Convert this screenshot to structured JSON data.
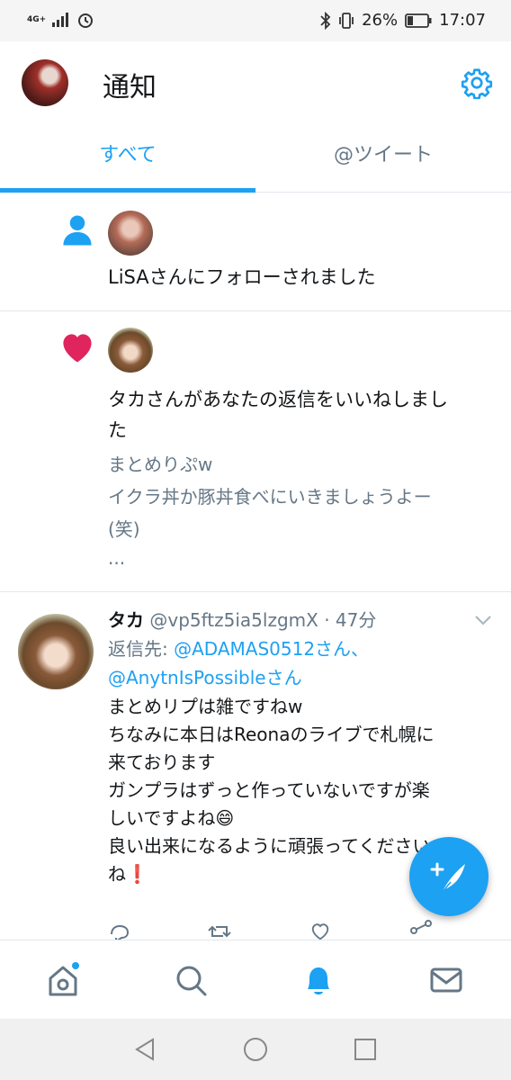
{
  "status_bar": {
    "network": "4G+",
    "battery": "26%",
    "time": "17:07"
  },
  "header": {
    "title": "通知"
  },
  "tabs": [
    {
      "label": "すべて",
      "active": true
    },
    {
      "label": "@ツイート",
      "active": false
    }
  ],
  "notifications": [
    {
      "type": "follow",
      "icon": "person-icon",
      "text": "LiSAさんにフォローされました"
    },
    {
      "type": "like",
      "icon": "heart-icon",
      "text_line1": "タカさんがあなたの返信をいいねしまし",
      "text_line2": "た",
      "quote_line1": "まとめりぷw",
      "quote_line2": "イクラ丼か豚丼食べにいきましょうよー",
      "quote_line3": "(笑)",
      "ellipsis": "..."
    }
  ],
  "tweet": {
    "name": "タカ",
    "handle_time": "@vp5ftz5ia5lzgmX · 47分",
    "reply_prefix": "返信先: ",
    "reply_to_1": "@ADAMAS0512さん、",
    "reply_to_2": "@AnytnIsPossibleさん",
    "body": [
      "まとめリプは雑ですねw",
      "ちなみに本日はReonaのライブで札幌に",
      "来ております",
      "ガンプラはずっと作っていないですが楽",
      "しいですよね😄",
      "良い出来になるように頑張ってください",
      "ね❗"
    ]
  },
  "colors": {
    "accent": "#1da1f2",
    "like": "#e0245e",
    "secondary_text": "#657786",
    "divider": "#e1e8ed"
  },
  "icons": {
    "settings": "gear-icon",
    "compose": "compose-tweet-icon",
    "nav": [
      "home-icon",
      "search-icon",
      "notifications-icon",
      "messages-icon"
    ],
    "system_nav": [
      "back-icon",
      "home-circle-icon",
      "recents-icon"
    ]
  }
}
